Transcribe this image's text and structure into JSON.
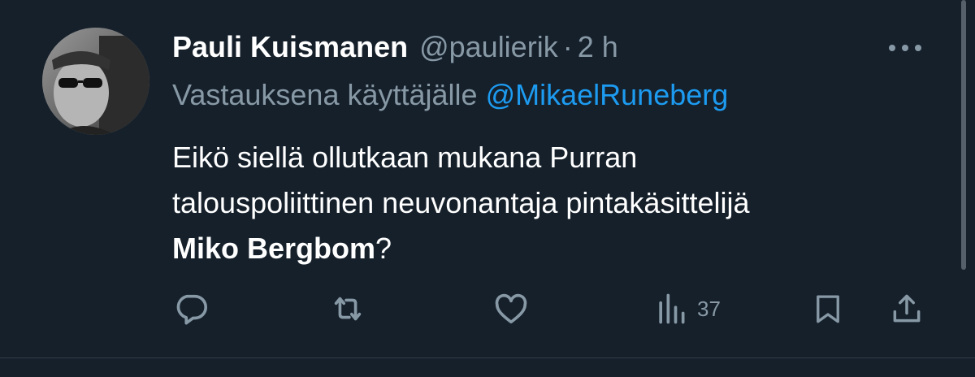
{
  "tweet": {
    "author": {
      "display_name": "Pauli Kuismanen",
      "handle": "@paulierik",
      "separator": "·",
      "time": "2 h"
    },
    "reply": {
      "prefix": "Vastauksena käyttäjälle",
      "mention": "@MikaelRuneberg"
    },
    "text": {
      "line1": "Eikö siellä ollutkaan mukana Purran",
      "line2": "talouspoliittinen neuvonantaja pintakäsittelijä",
      "bold_name": "Miko Bergbom",
      "suffix": "?"
    },
    "actions": {
      "views_count": "37"
    }
  },
  "icons": {
    "more": "more-dots-icon",
    "reply": "reply-bubble-icon",
    "retweet": "retweet-icon",
    "like": "heart-icon",
    "views": "views-bars-icon",
    "bookmark": "bookmark-icon",
    "share": "share-icon"
  },
  "colors": {
    "background": "#15202b",
    "text_primary": "#ffffff",
    "text_secondary": "#8899a6",
    "link": "#1d9bf0"
  }
}
